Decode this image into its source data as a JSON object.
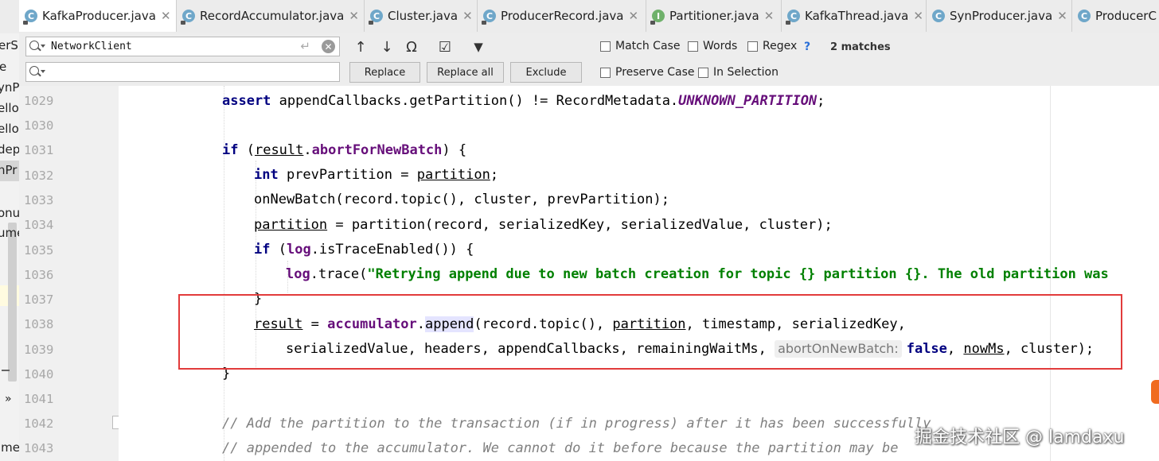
{
  "tabs": [
    {
      "label": "KafkaProducer.java",
      "icon": "C",
      "locked": true,
      "active": true
    },
    {
      "label": "RecordAccumulator.java",
      "icon": "C",
      "locked": true,
      "active": false
    },
    {
      "label": "Cluster.java",
      "icon": "C",
      "locked": true,
      "active": false
    },
    {
      "label": "ProducerRecord.java",
      "icon": "C",
      "locked": true,
      "active": false
    },
    {
      "label": "Partitioner.java",
      "icon": "I",
      "locked": true,
      "active": false
    },
    {
      "label": "KafkaThread.java",
      "icon": "C",
      "locked": true,
      "active": false
    },
    {
      "label": "SynProducer.java",
      "icon": "C",
      "locked": false,
      "active": false
    },
    {
      "label": "ProducerC",
      "icon": "C",
      "locked": false,
      "active": false
    }
  ],
  "close_glyph": "✕",
  "left_fragments": [
    "erS",
    "e",
    "ynP",
    "ello",
    "ello",
    "dep",
    "nPr",
    "onus",
    "ume",
    "ime"
  ],
  "left_glyphs": {
    "arrows": "»"
  },
  "find": {
    "search_value": "NetworkClient",
    "enter_glyph": "↵",
    "clear_glyph": "✕",
    "replace_value": "",
    "toolbar": {
      "prev": "↑",
      "next": "↓",
      "find_all": "Ω",
      "select_all": "☑",
      "filter": "▼"
    },
    "buttons": {
      "replace": "Replace",
      "replace_all": "Replace all",
      "exclude": "Exclude"
    },
    "options": {
      "match_case": "Match Case",
      "words": "Words",
      "regex": "Regex",
      "help": "?",
      "preserve_case": "Preserve Case",
      "in_selection": "In Selection"
    },
    "matches": "2 matches"
  },
  "line_numbers": [
    "1029",
    "1030",
    "1031",
    "1032",
    "1033",
    "1034",
    "1035",
    "1036",
    "1037",
    "1038",
    "1039",
    "1040",
    "1041",
    "1042",
    "1043"
  ],
  "code": {
    "l1029": {
      "kw": "assert",
      "a": " appendCallbacks.getPartition() != RecordMetadata.",
      "const": "UNKNOWN_PARTITION",
      "b": ";"
    },
    "l1031": {
      "kw": "if",
      "a": " (",
      "v": "result",
      "dot": ".",
      "fld": "abortForNewBatch",
      "b": ") {"
    },
    "l1032": {
      "kw": "int",
      "a": " prevPartition = ",
      "v": "partition",
      "b": ";"
    },
    "l1033": {
      "a": "onNewBatch(record.topic(), cluster, prevPartition);"
    },
    "l1034": {
      "v": "partition",
      "a": " = partition(record, serializedKey, serializedValue, cluster);"
    },
    "l1035": {
      "kw": "if",
      "a": " (",
      "fld": "log",
      "b": ".isTraceEnabled()) {"
    },
    "l1036": {
      "fld": "log",
      "a": ".trace(",
      "str": "\"Retrying append due to new batch creation for topic {} partition {}. The old partition was"
    },
    "l1037": {
      "a": "}"
    },
    "l1038": {
      "v": "result",
      "a": " = ",
      "fld": "accumulator",
      "dot": ".",
      "hl": "append",
      "b": "(record.topic(), ",
      "v2": "partition",
      "c": ", timestamp, serializedKey,"
    },
    "l1039": {
      "a": "serializedValue, headers, appendCallbacks, remainingWaitMs, ",
      "hint": "abortOnNewBatch:",
      "kw": "false",
      "b": ", ",
      "v": "nowMs",
      "c": ", cluster);"
    },
    "l1040": {
      "a": "}"
    },
    "l1042": {
      "a": "// Add the partition to the transaction (if in progress) after it has been successfully"
    },
    "l1043": {
      "a": "// appended to the accumulator. We cannot do it before because the partition may be"
    }
  },
  "watermark": "掘金技术社区 @ lamdaxu",
  "colors": {
    "highlight_box": "#e23b3b",
    "keyword": "#000080",
    "field": "#660e7a",
    "string": "#008000",
    "comment": "#808080"
  }
}
